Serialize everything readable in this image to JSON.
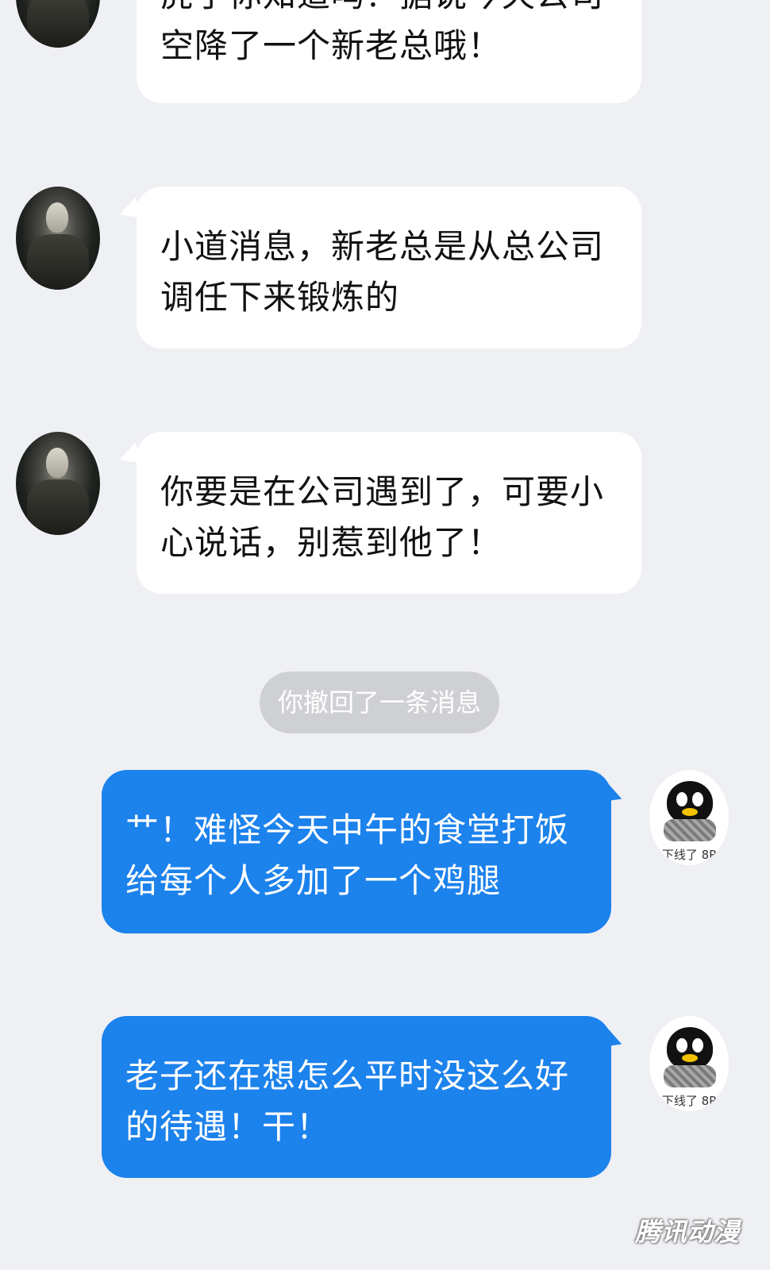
{
  "messages": [
    {
      "side": "incoming",
      "lines": [
        "虎子你知道吗？据说今天公司",
        "空降了一个新老总哦！"
      ]
    },
    {
      "side": "incoming",
      "lines": [
        "小道消息，新老总是从总公司",
        "调任下来锻炼的"
      ]
    },
    {
      "side": "incoming",
      "lines": [
        "你要是在公司遇到了，可要小",
        "心说话，别惹到他了！"
      ]
    },
    {
      "side": "outgoing",
      "lines": [
        "艹！难怪今天中午的食堂打饭",
        "给每个人多加了一个鸡腿"
      ]
    },
    {
      "side": "outgoing",
      "lines": [
        "老子还在想怎么平时没这么好",
        "的待遇！干！"
      ]
    }
  ],
  "system_notice": "你撤回了一条消息",
  "self_avatar_caption": "下线了 8P",
  "watermark": "腾讯动漫",
  "colors": {
    "background": "#eff0f4",
    "incoming_bubble": "#ffffff",
    "outgoing_bubble": "#1c82ec",
    "system_pill": "#cfd0d4"
  }
}
